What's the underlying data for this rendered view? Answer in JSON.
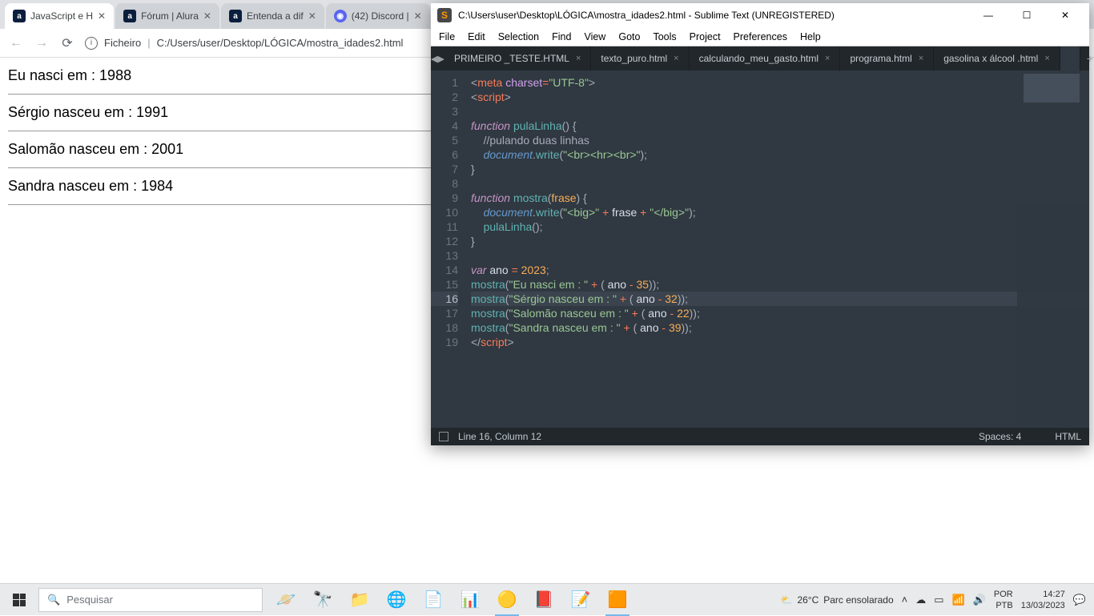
{
  "chrome": {
    "tabs": [
      {
        "favType": "alura",
        "title": "JavaScript e H"
      },
      {
        "favType": "alura",
        "title": "Fórum | Alura"
      },
      {
        "favType": "alura",
        "title": "Entenda a dif"
      },
      {
        "favType": "discord",
        "title": "(42) Discord |"
      }
    ],
    "url_prefix": "Ficheiro",
    "url": "C:/Users/user/Desktop/LÓGICA/mostra_idades2.html",
    "page_lines": [
      "Eu nasci em : 1988",
      "Sérgio nasceu em : 1991",
      "Salomão nasceu em : 2001",
      "Sandra nasceu em : 1984"
    ]
  },
  "sublime": {
    "title": "C:\\Users\\user\\Desktop\\LÓGICA\\mostra_idades2.html - Sublime Text (UNREGISTERED)",
    "menu": [
      "File",
      "Edit",
      "Selection",
      "Find",
      "View",
      "Goto",
      "Tools",
      "Project",
      "Preferences",
      "Help"
    ],
    "tabs": [
      "PRIMEIRO _TESTE.HTML",
      "texto_puro.html",
      "calculando_meu_gasto.html",
      "programa.html",
      "gasolina x álcool .html"
    ],
    "status_left": "Line 16, Column 12",
    "status_spaces": "Spaces: 4",
    "status_lang": "HTML"
  },
  "taskbar": {
    "search_placeholder": "Pesquisar",
    "weather_temp": "26°C",
    "weather_text": "Parc ensolarado",
    "lang1": "POR",
    "lang2": "PTB",
    "time": "14:27",
    "date": "13/03/2023"
  }
}
